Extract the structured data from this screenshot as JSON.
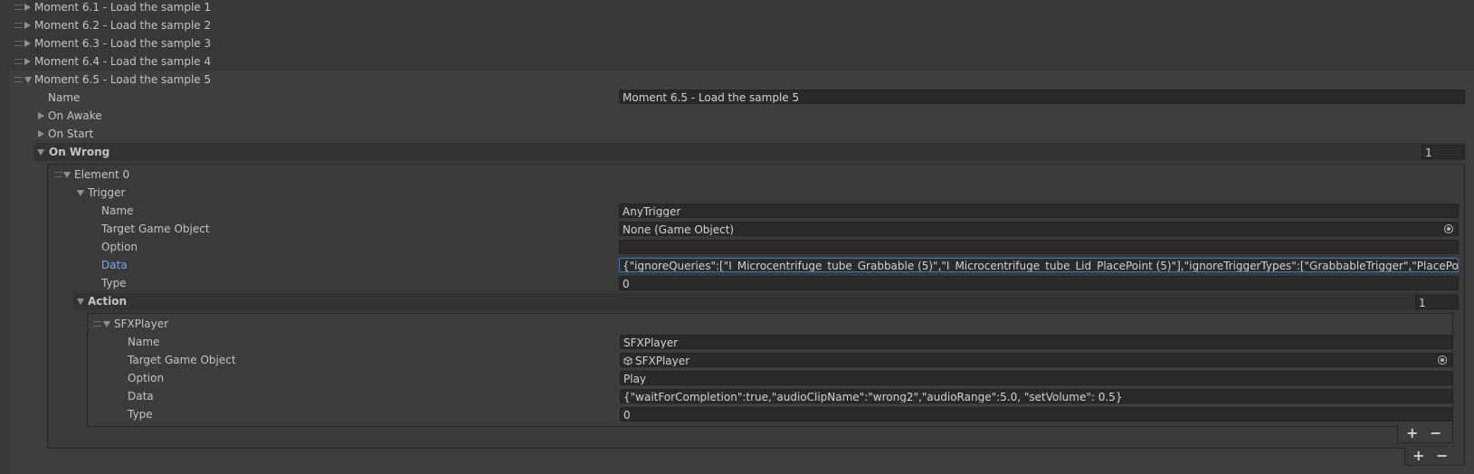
{
  "moments": [
    {
      "label": "Moment 6.1 - Load the sample 1"
    },
    {
      "label": "Moment 6.2 - Load the sample 2"
    },
    {
      "label": "Moment 6.3 - Load the sample 3"
    },
    {
      "label": "Moment 6.4 - Load the sample 4"
    },
    {
      "label": "Moment 6.5 - Load the sample 5"
    }
  ],
  "moment_name": {
    "label": "Name",
    "value": "Moment 6.5 - Load the sample 5"
  },
  "on_awake": "On Awake",
  "on_start": "On Start",
  "on_wrong": {
    "label": "On Wrong",
    "size": "1"
  },
  "element0": {
    "label": "Element 0",
    "trigger": {
      "label": "Trigger",
      "name": {
        "label": "Name",
        "value": "AnyTrigger"
      },
      "target": {
        "label": "Target Game Object",
        "value": "None (Game Object)"
      },
      "option": {
        "label": "Option",
        "value": ""
      },
      "data": {
        "label": "Data",
        "value": "{\"ignoreQueries\":[\"I_Microcentrifuge_tube_Grabbable (5)\",\"I_Microcentrifuge_tube_Lid_PlacePoint (5)\"],\"ignoreTriggerTypes\":[\"GrabbableTrigger\",\"PlacePointTrigger\"]"
      },
      "type": {
        "label": "Type",
        "value": "0"
      }
    },
    "action": {
      "label": "Action",
      "size": "1",
      "sfx": {
        "label": "SFXPlayer",
        "name": {
          "label": "Name",
          "value": "SFXPlayer"
        },
        "target": {
          "label": "Target Game Object",
          "value": "SFXPlayer"
        },
        "option": {
          "label": "Option",
          "value": "Play"
        },
        "data": {
          "label": "Data",
          "value": "{\"waitForCompletion\":true,\"audioClipName\":\"wrong2\",\"audioRange\":5.0, \"setVolume\": 0.5}"
        },
        "type": {
          "label": "Type",
          "value": "0"
        }
      }
    }
  },
  "buttons": {
    "plus": "+",
    "minus": "−"
  },
  "colors": {
    "background": "#383838",
    "active_label": "#7ba7e6",
    "focus_border": "#3a79bb"
  }
}
